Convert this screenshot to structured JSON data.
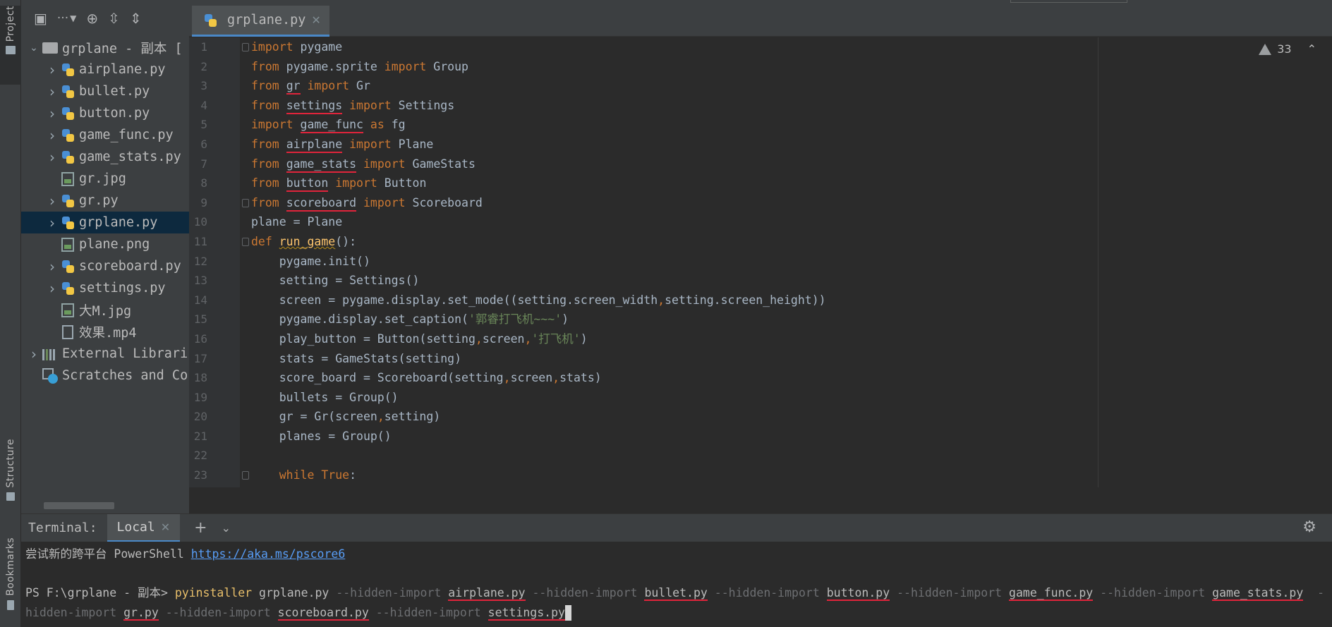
{
  "tool_stripe": {
    "project_tab": "Project",
    "structure_tab": "Structure",
    "bookmarks_tab": "Bookmarks"
  },
  "project_panel": {
    "toolbar_more": "···",
    "tree": [
      {
        "label": "grplane - 副本 [",
        "type": "folder",
        "expand": "down",
        "indent": 0
      },
      {
        "label": "airplane.py",
        "type": "py",
        "expand": "right",
        "indent": 1
      },
      {
        "label": "bullet.py",
        "type": "py",
        "expand": "right",
        "indent": 1
      },
      {
        "label": "button.py",
        "type": "py",
        "expand": "right",
        "indent": 1
      },
      {
        "label": "game_func.py",
        "type": "py",
        "expand": "right",
        "indent": 1
      },
      {
        "label": "game_stats.py",
        "type": "py",
        "expand": "right",
        "indent": 1
      },
      {
        "label": "gr.jpg",
        "type": "img",
        "expand": "",
        "indent": 1
      },
      {
        "label": "gr.py",
        "type": "py",
        "expand": "right",
        "indent": 1
      },
      {
        "label": "grplane.py",
        "type": "py",
        "expand": "right",
        "indent": 1,
        "selected": true
      },
      {
        "label": "plane.png",
        "type": "img",
        "expand": "",
        "indent": 1
      },
      {
        "label": "scoreboard.py",
        "type": "py",
        "expand": "right",
        "indent": 1
      },
      {
        "label": "settings.py",
        "type": "py",
        "expand": "right",
        "indent": 1
      },
      {
        "label": "大M.jpg",
        "type": "img",
        "expand": "",
        "indent": 1
      },
      {
        "label": "效果.mp4",
        "type": "file",
        "expand": "",
        "indent": 1
      },
      {
        "label": "External Librari",
        "type": "lib",
        "expand": "right",
        "indent": 0
      },
      {
        "label": "Scratches and Co",
        "type": "scratch",
        "expand": "",
        "indent": 0
      }
    ]
  },
  "editor": {
    "tab_label": "grplane.py",
    "inspection_count": "33",
    "line_numbers": [
      "1",
      "2",
      "3",
      "4",
      "5",
      "6",
      "7",
      "8",
      "9",
      "10",
      "11",
      "12",
      "13",
      "14",
      "15",
      "16",
      "17",
      "18",
      "19",
      "20",
      "21",
      "22",
      "23"
    ],
    "lines": [
      "import pygame",
      "from pygame.sprite import Group",
      "from gr import Gr",
      "from settings import Settings",
      "import game_func as fg",
      "from airplane import Plane",
      "from game_stats import GameStats",
      "from button import Button",
      "from scoreboard import Scoreboard",
      "plane = Plane",
      "def run_game():",
      "    pygame.init()",
      "    setting = Settings()",
      "    screen = pygame.display.set_mode((setting.screen_width,setting.screen_height))",
      "    pygame.display.set_caption('郭睿打飞机~~~')",
      "    play_button = Button(setting,screen,'打飞机')",
      "    stats = GameStats(setting)",
      "    score_board = Scoreboard(setting,screen,stats)",
      "    bullets = Group()",
      "    gr = Gr(screen,setting)",
      "    planes = Group()",
      "",
      "    while True:"
    ]
  },
  "terminal": {
    "title": "Terminal:",
    "tab_label": "Local",
    "line1_text": "尝试新的跨平台 PowerShell ",
    "line1_link": "https://aka.ms/pscore6",
    "prompt": "PS F:\\grplane - 副本> ",
    "command": "pyinstaller",
    "main_file": " grplane.py ",
    "hidden_opt": "--hidden-import",
    "line3_tail": " -",
    "line4_head": "hidden-import",
    "modules_line3": [
      "airplane.py",
      "bullet.py",
      "button.py",
      "game_func.py",
      "game_stats.py"
    ],
    "modules_line4": [
      "gr.py",
      "scoreboard.py",
      "settings.py"
    ]
  },
  "colors": {
    "keyword": "#cc7832",
    "function": "#ffc66d",
    "string": "#6a8759",
    "annotation_red": "#e0243b",
    "link": "#589df6"
  }
}
